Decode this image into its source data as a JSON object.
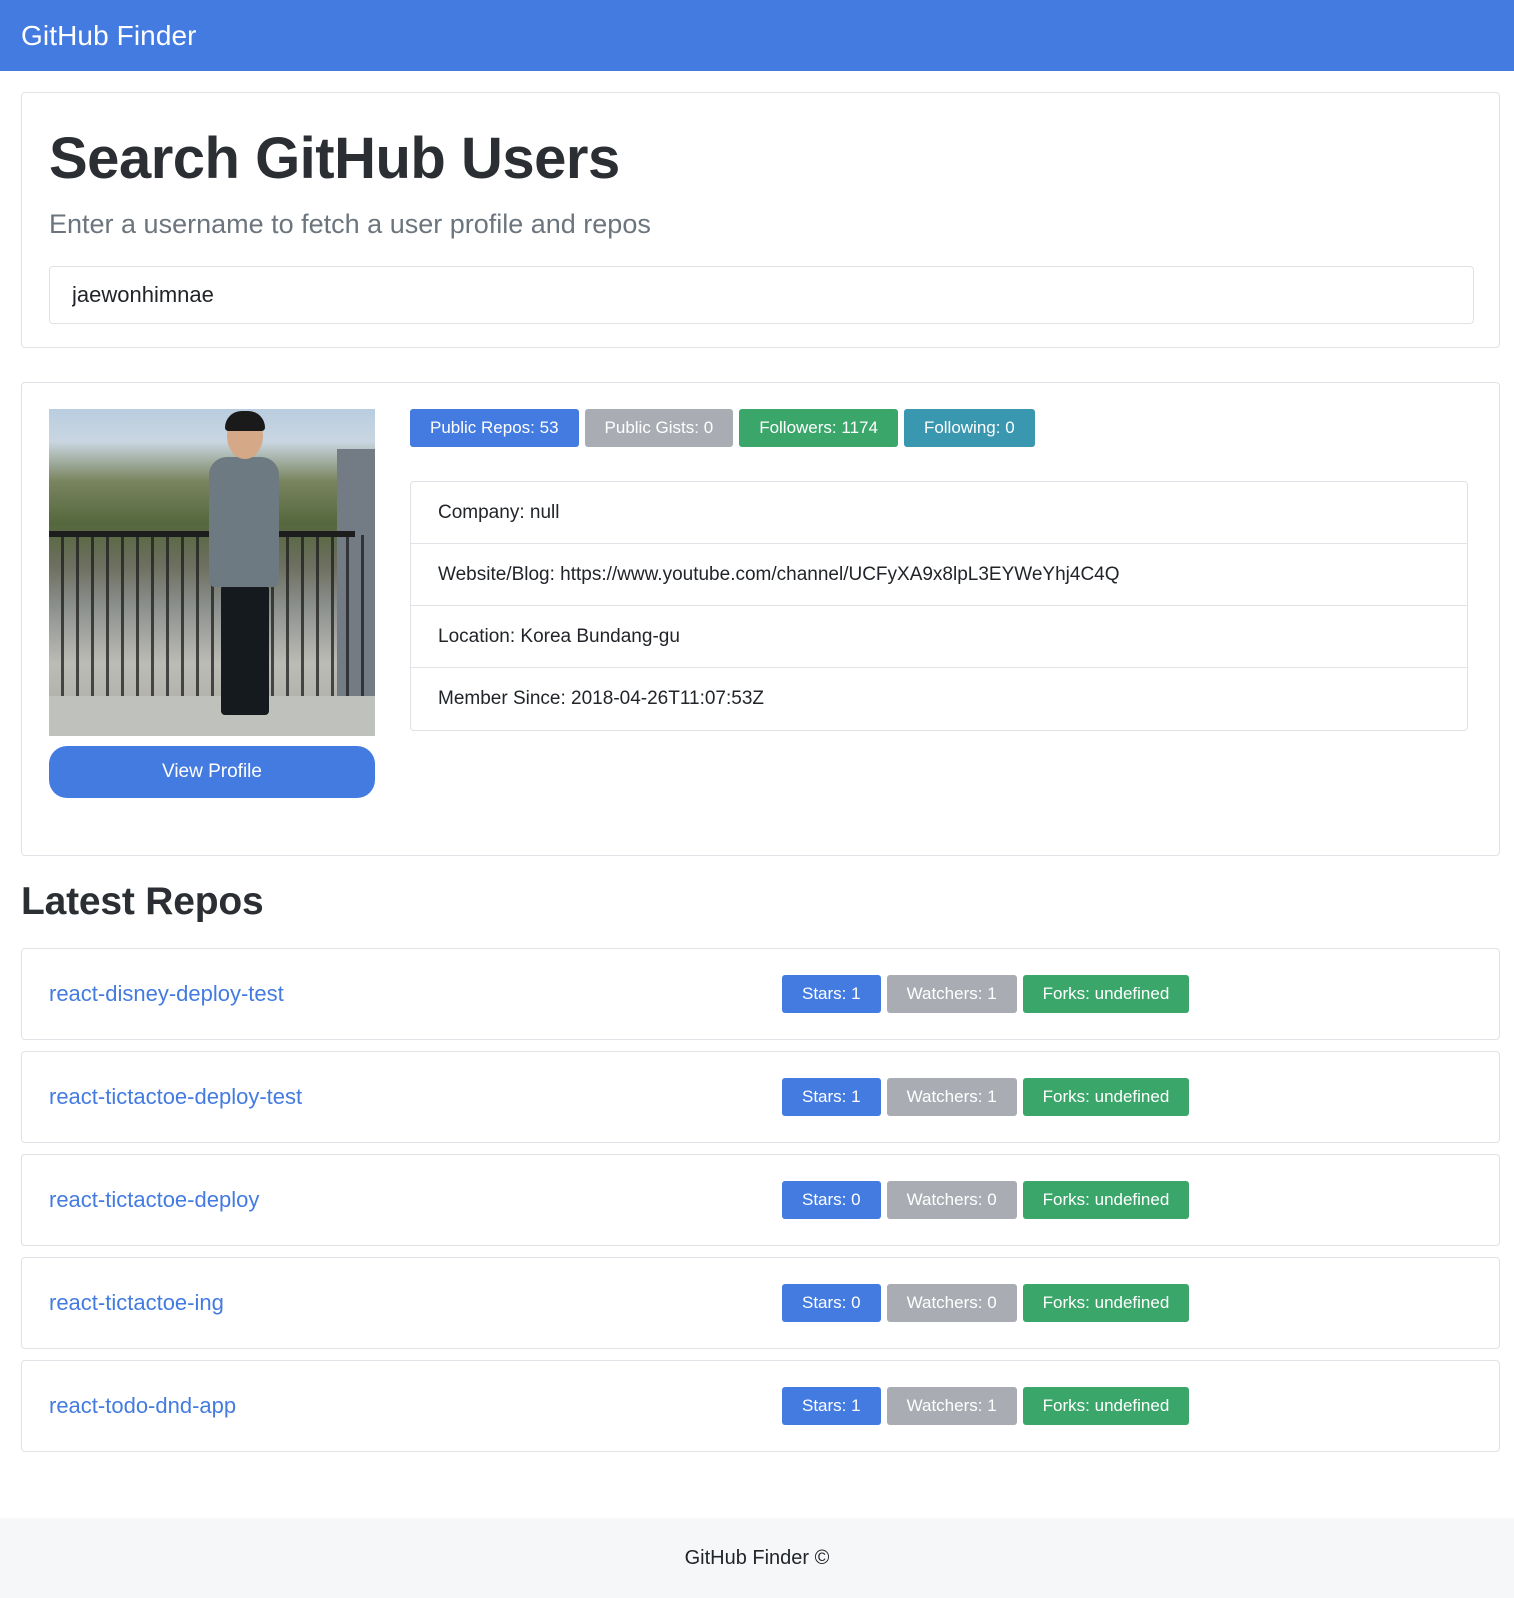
{
  "navbar": {
    "brand": "GitHub Finder"
  },
  "search": {
    "heading": "Search GitHub Users",
    "lead": "Enter a username to fetch a user profile and repos",
    "input_value": "jaewonhimnae"
  },
  "profile": {
    "view_profile_label": "View Profile",
    "badges": [
      {
        "text": "Public Repos: 53",
        "color": "#437be0"
      },
      {
        "text": "Public Gists: 0",
        "color": "#a9adb3"
      },
      {
        "text": "Followers: 1174",
        "color": "#3aa66a"
      },
      {
        "text": "Following: 0",
        "color": "#3a97b0"
      }
    ],
    "info": {
      "company": "Company: null",
      "website": "Website/Blog: https://www.youtube.com/channel/UCFyXA9x8lpL3EYWeYhj4C4Q",
      "location": "Location: Korea Bundang-gu",
      "member_since": "Member Since: 2018-04-26T11:07:53Z"
    }
  },
  "repos": {
    "title": "Latest Repos",
    "items": [
      {
        "name": "react-disney-deploy-test",
        "stars": "Stars: 1",
        "watchers": "Watchers: 1",
        "forks": "Forks: undefined"
      },
      {
        "name": "react-tictactoe-deploy-test",
        "stars": "Stars: 1",
        "watchers": "Watchers: 1",
        "forks": "Forks: undefined"
      },
      {
        "name": "react-tictactoe-deploy",
        "stars": "Stars: 0",
        "watchers": "Watchers: 0",
        "forks": "Forks: undefined"
      },
      {
        "name": "react-tictactoe-ing",
        "stars": "Stars: 0",
        "watchers": "Watchers: 0",
        "forks": "Forks: undefined"
      },
      {
        "name": "react-todo-dnd-app",
        "stars": "Stars: 1",
        "watchers": "Watchers: 1",
        "forks": "Forks: undefined"
      }
    ]
  },
  "footer": {
    "text": "GitHub Finder ©"
  },
  "colors": {
    "primary": "#437be0",
    "secondary": "#a9adb3",
    "success": "#3aa66a",
    "info": "#3a97b0"
  }
}
